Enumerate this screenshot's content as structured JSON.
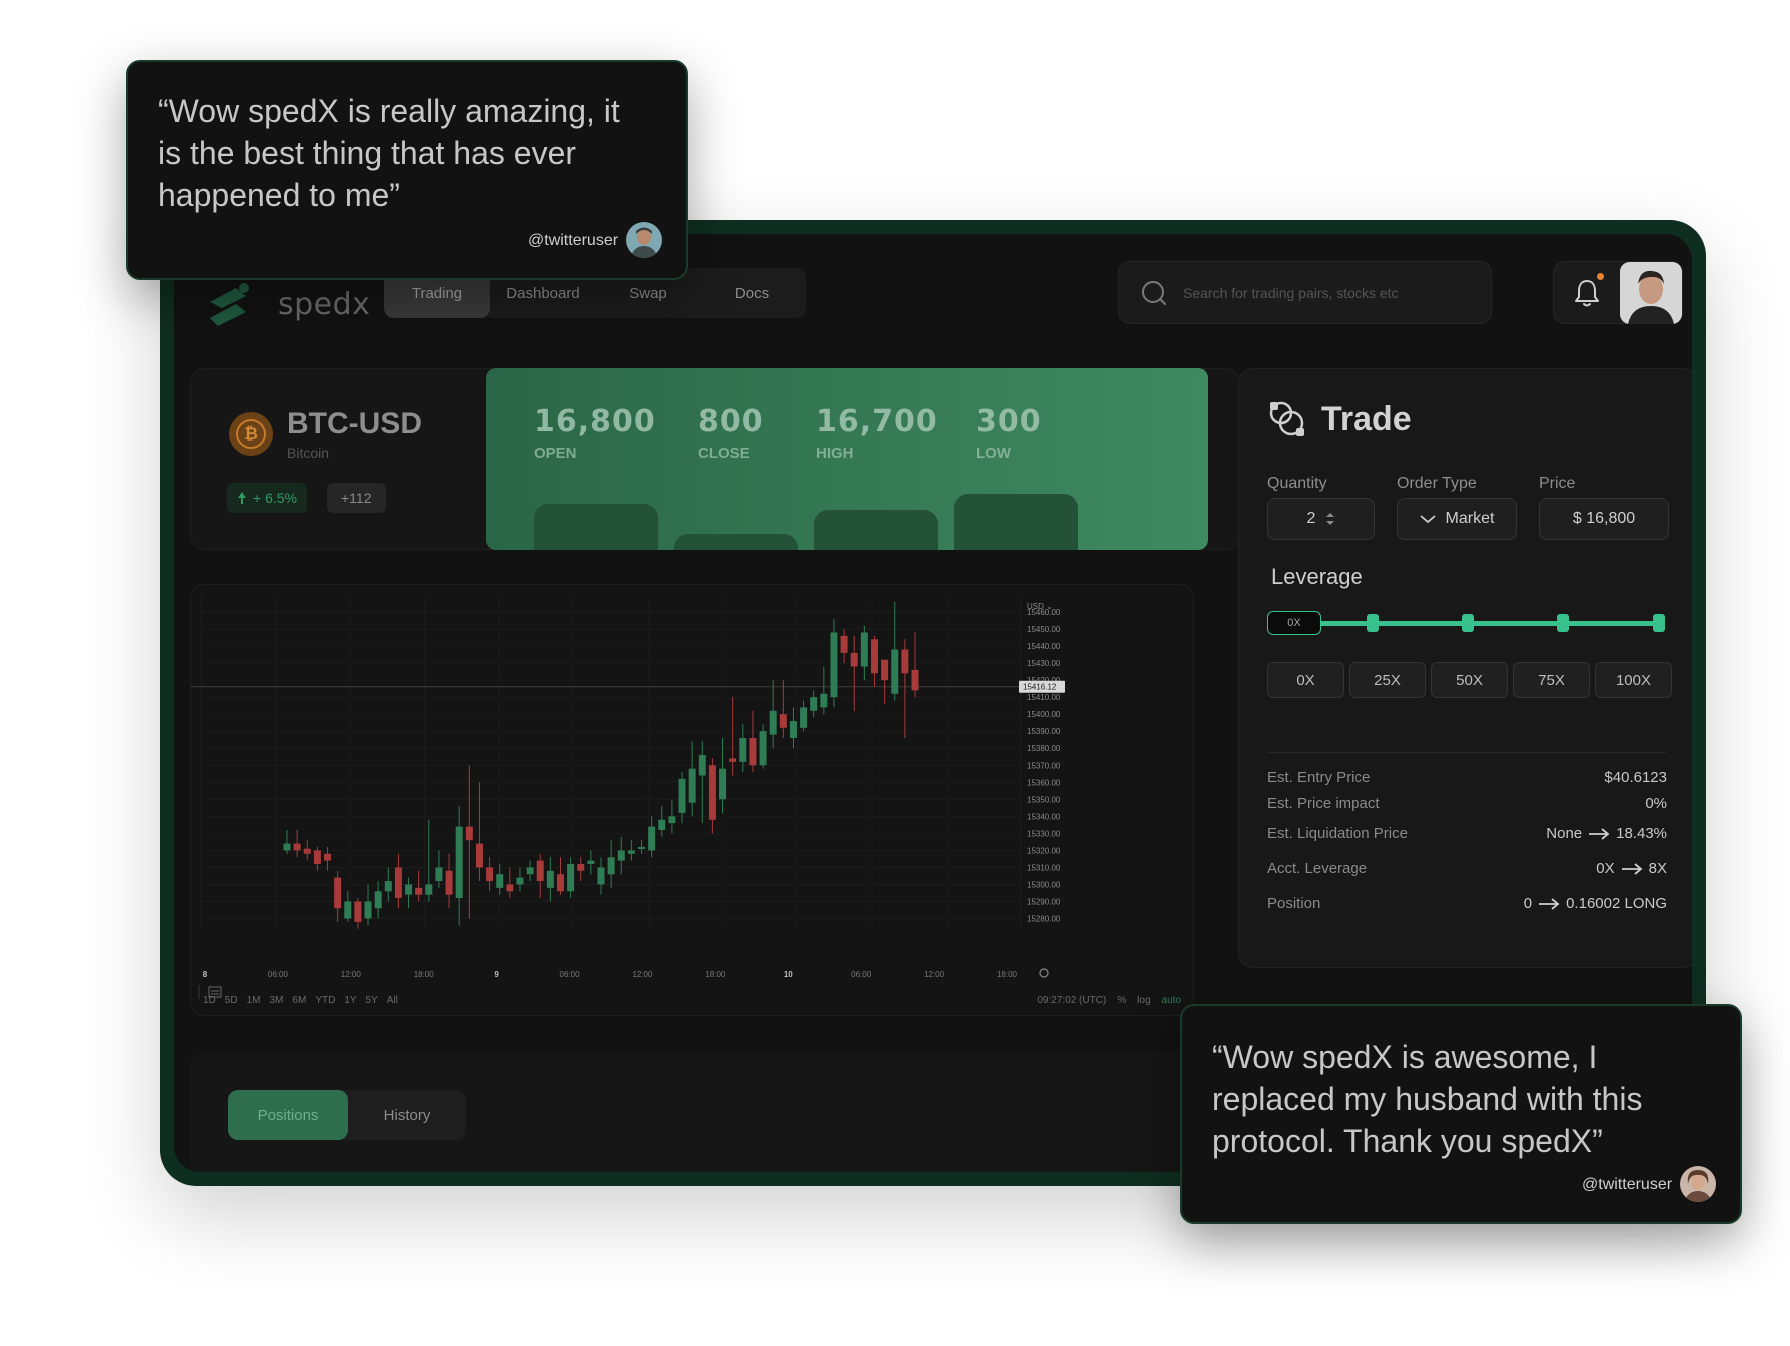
{
  "app": {
    "logo_text": "spedx"
  },
  "nav": {
    "items": [
      "Trading",
      "Dashboard",
      "Swap",
      "Docs"
    ],
    "active": "Trading"
  },
  "search": {
    "placeholder": "Search for trading pairs, stocks etc"
  },
  "ticker": {
    "symbol": "BTC-USD",
    "name": "Bitcoin",
    "change": "+ 6.5%",
    "count": "+112",
    "stats": [
      {
        "value": "16,800",
        "label": "OPEN"
      },
      {
        "value": "800",
        "label": "CLOSE"
      },
      {
        "value": "16,700",
        "label": "HIGH"
      },
      {
        "value": "300",
        "label": "LOW"
      }
    ]
  },
  "chart_data": {
    "type": "candlestick",
    "currency_label": "USD ⌄",
    "current_price_label": "15416.12",
    "current_price": 15416.12,
    "ylim": [
      15275,
      15470
    ],
    "y_ticks": [
      "15460.00",
      "15450.00",
      "15440.00",
      "15430.00",
      "15420.00",
      "15410.00",
      "15400.00",
      "15390.00",
      "15380.00",
      "15370.00",
      "15360.00",
      "15350.00",
      "15340.00",
      "15330.00",
      "15320.00",
      "15310.00",
      "15300.00",
      "15290.00",
      "15280.00"
    ],
    "x_ticks": [
      "8",
      "06:00",
      "12:00",
      "18:00",
      "9",
      "06:00",
      "12:00",
      "18:00",
      "10",
      "06:00",
      "12:00",
      "18:00"
    ],
    "candles": [
      [
        15320,
        15324,
        15332,
        15318
      ],
      [
        15324,
        15320,
        15332,
        15316
      ],
      [
        15321,
        15318,
        15326,
        15314
      ],
      [
        15320,
        15312,
        15322,
        15308
      ],
      [
        15318,
        15314,
        15322,
        15308
      ],
      [
        15304,
        15286,
        15308,
        15278
      ],
      [
        15280,
        15290,
        15296,
        15278
      ],
      [
        15290,
        15278,
        15292,
        15274
      ],
      [
        15280,
        15290,
        15300,
        15276
      ],
      [
        15286,
        15296,
        15302,
        15280
      ],
      [
        15296,
        15302,
        15310,
        15290
      ],
      [
        15310,
        15292,
        15318,
        15286
      ],
      [
        15294,
        15300,
        15304,
        15286
      ],
      [
        15298,
        15294,
        15308,
        15290
      ],
      [
        15294,
        15300,
        15338,
        15290
      ],
      [
        15302,
        15310,
        15320,
        15298
      ],
      [
        15308,
        15294,
        15318,
        15286
      ],
      [
        15292,
        15334,
        15346,
        15276
      ],
      [
        15334,
        15326,
        15370,
        15280
      ],
      [
        15324,
        15310,
        15360,
        15302
      ],
      [
        15310,
        15302,
        15316,
        15296
      ],
      [
        15298,
        15306,
        15312,
        15294
      ],
      [
        15300,
        15296,
        15310,
        15292
      ],
      [
        15300,
        15304,
        15310,
        15296
      ],
      [
        15306,
        15310,
        15314,
        15302
      ],
      [
        15314,
        15302,
        15318,
        15292
      ],
      [
        15298,
        15308,
        15316,
        15290
      ],
      [
        15306,
        15296,
        15316,
        15294
      ],
      [
        15296,
        15312,
        15316,
        15292
      ],
      [
        15312,
        15308,
        15316,
        15302
      ],
      [
        15312,
        15314,
        15320,
        15306
      ],
      [
        15300,
        15310,
        15316,
        15294
      ],
      [
        15306,
        15316,
        15326,
        15298
      ],
      [
        15314,
        15320,
        15328,
        15306
      ],
      [
        15318,
        15320,
        15326,
        15314
      ],
      [
        15322,
        15322,
        15326,
        15318
      ],
      [
        15320,
        15334,
        15340,
        15316
      ],
      [
        15332,
        15338,
        15346,
        15328
      ],
      [
        15336,
        15340,
        15350,
        15330
      ],
      [
        15342,
        15362,
        15366,
        15336
      ],
      [
        15348,
        15368,
        15384,
        15340
      ],
      [
        15364,
        15376,
        15384,
        15336
      ],
      [
        15370,
        15338,
        15374,
        15330
      ],
      [
        15350,
        15368,
        15386,
        15342
      ],
      [
        15374,
        15372,
        15410,
        15364
      ],
      [
        15372,
        15386,
        15394,
        15366
      ],
      [
        15386,
        15370,
        15402,
        15366
      ],
      [
        15370,
        15390,
        15394,
        15368
      ],
      [
        15388,
        15402,
        15420,
        15380
      ],
      [
        15400,
        15392,
        15420,
        15386
      ],
      [
        15386,
        15396,
        15404,
        15380
      ],
      [
        15392,
        15404,
        15408,
        15390
      ],
      [
        15402,
        15410,
        15414,
        15398
      ],
      [
        15404,
        15412,
        15428,
        15400
      ],
      [
        15410,
        15448,
        15456,
        15404
      ],
      [
        15446,
        15436,
        15450,
        15430
      ],
      [
        15436,
        15428,
        15446,
        15402
      ],
      [
        15428,
        15448,
        15452,
        15420
      ],
      [
        15444,
        15424,
        15446,
        15416
      ],
      [
        15432,
        15420,
        15430,
        15406
      ],
      [
        15412,
        15438,
        15466,
        15408
      ],
      [
        15438,
        15424,
        15444,
        15386
      ],
      [
        15426,
        15414,
        15448,
        15410
      ]
    ],
    "timeframes": [
      "1D",
      "5D",
      "1M",
      "3M",
      "6M",
      "YTD",
      "1Y",
      "5Y",
      "All"
    ],
    "footer_time": "09:27:02 (UTC)",
    "footer_opts": [
      "%",
      "log",
      "auto"
    ],
    "colors": {
      "up": "#2e7d55",
      "down": "#a83a3a"
    }
  },
  "positions": {
    "tabs": [
      "Positions",
      "History"
    ],
    "active": "Positions"
  },
  "trade": {
    "title": "Trade",
    "fields": [
      {
        "label": "Quantity",
        "value": "2"
      },
      {
        "label": "Order Type",
        "value": "Market"
      },
      {
        "label": "Price",
        "value": "$ 16,800"
      }
    ],
    "leverage_title": "Leverage",
    "leverage_value": "0X",
    "leverage_options": [
      "0X",
      "25X",
      "50X",
      "75X",
      "100X"
    ],
    "estimates": [
      {
        "key": "Est. Entry Price",
        "from": "",
        "to": "$40.6123"
      },
      {
        "key": "Est. Price impact",
        "from": "",
        "to": "0%"
      },
      {
        "key": "Est. Liquidation Price",
        "from": "None",
        "to": "18.43%"
      },
      {
        "key": "Acct. Leverage",
        "from": "0X",
        "to": "8X"
      },
      {
        "key": "Position",
        "from": "0",
        "to": "0.16002 LONG"
      }
    ]
  },
  "testimonials": [
    {
      "text": "“Wow spedX is really amazing, it is the best thing that has ever happened to me”",
      "handle": "@twitteruser"
    },
    {
      "text": "“Wow spedX is awesome, I replaced my husband with this protocol. Thank you spedX”",
      "handle": "@twitteruser"
    }
  ],
  "accent": "#39c18d"
}
